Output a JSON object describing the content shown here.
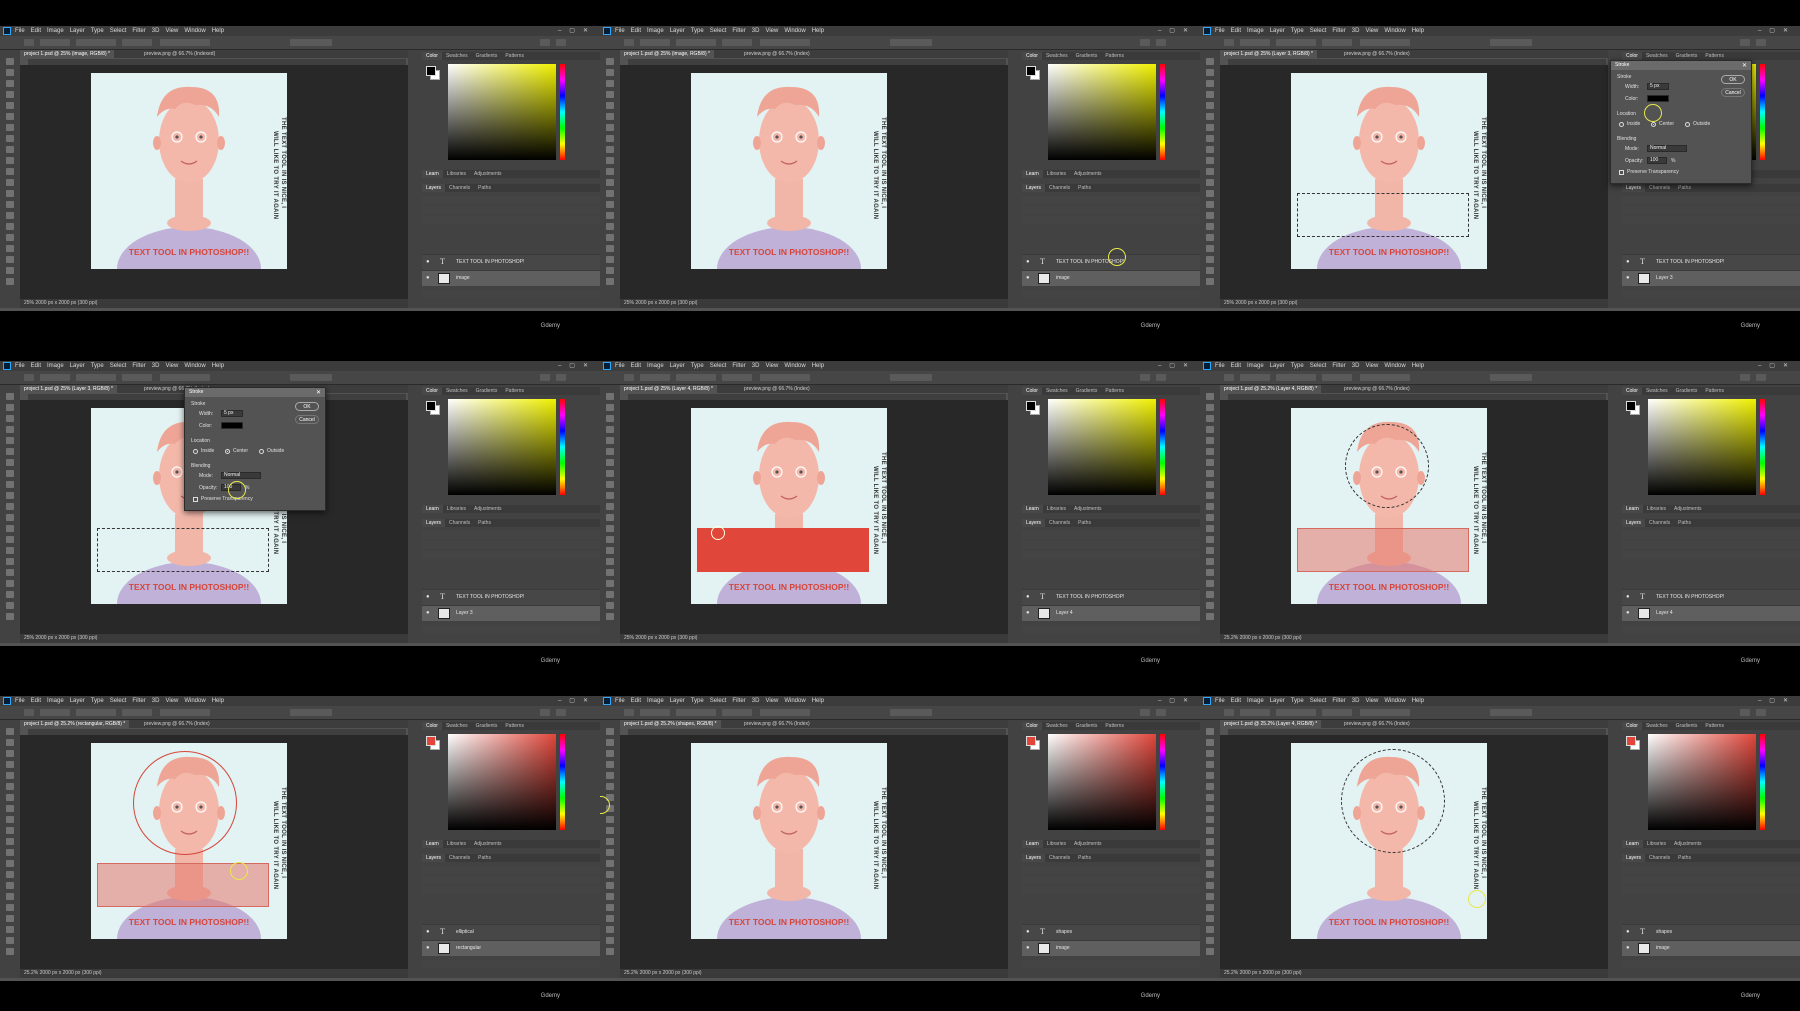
{
  "menu": [
    "File",
    "Edit",
    "Image",
    "Layer",
    "Type",
    "Select",
    "Filter",
    "3D",
    "View",
    "Window",
    "Help"
  ],
  "watermark": "Gdemy",
  "colors": {
    "accent_yellow": "#e8e84a",
    "title_red": "#d6453a",
    "fill_red": "#e0463a",
    "panel_dark": "#424242",
    "canvas_bg": "#e3f2f2"
  },
  "panel_tabs_top": [
    "Color",
    "Swatches",
    "Gradients",
    "Patterns"
  ],
  "panel_tabs_mid": [
    "Learn",
    "Libraries",
    "Adjustments"
  ],
  "panel_tabs_layers": [
    "Layers",
    "Channels",
    "Paths"
  ],
  "artwork": {
    "vertical_text_line1": "THE TEXT TOOL IN",
    "vertical_text_line2": "WILL LIKE TO TRY IT AGAIN",
    "vertical_text_mid": "IS NICE, I",
    "title": "TEXT TOOL IN PHOTOSHOP!!"
  },
  "layer_text": "TEXT TOOL IN PHOTOSHOP!",
  "stroke_dialog": {
    "title": "Stroke",
    "section_stroke": "Stroke",
    "width_label": "Width:",
    "width_value": "5 px",
    "color_label": "Color:",
    "location_label": "Location",
    "inside": "Inside",
    "center": "Center",
    "outside": "Outside",
    "blending_label": "Blending",
    "mode_label": "Mode:",
    "mode_value": "Normal",
    "opacity_label": "Opacity:",
    "opacity_value": "100",
    "opacity_unit": "%",
    "preserve": "Preserve Transparency",
    "ok": "OK",
    "cancel": "Cancel"
  },
  "frames": [
    {
      "tab": "project 1.psd @ 25% (image, RGB/8) *",
      "tab2": "preview.png @ 66.7% (Indexed)",
      "layer_top": "TEXT TOOL IN PHOTOSHOP!",
      "layer_bottom": "image",
      "status": "25%   2000 px x 2000 px (300 ppi)"
    },
    {
      "tab": "project 1.psd @ 25% (image, RGB/8) *",
      "tab2": "preview.png @ 66.7% (Index)",
      "layer_top": "TEXT TOOL IN PHOTOSHOP!",
      "layer_bottom": "image",
      "status": "25%   2000 px x 2000 px (300 ppi)"
    },
    {
      "tab": "project 1.psd @ 25% (Layer 3, RGB/8) *",
      "tab2": "preview.png @ 66.7% (Index)",
      "layer_top": "TEXT TOOL IN PHOTOSHOP!",
      "layer_bottom": "Layer 3",
      "status": "25%   2000 px x 2000 px (300 ppi)"
    },
    {
      "tab": "project 1.psd @ 25% (Layer 3, RGB/8) *",
      "tab2": "preview.png @ 66.7% (Index)",
      "layer_top": "TEXT TOOL IN PHOTOSHOP!",
      "layer_bottom": "Layer 3",
      "status": "25%   2000 px x 2000 px (300 ppi)"
    },
    {
      "tab": "project 1.psd @ 25% (Layer 4, RGB/8) *",
      "tab2": "preview.png @ 66.7% (Index)",
      "layer_top": "TEXT TOOL IN PHOTOSHOP!",
      "layer_bottom": "Layer 4",
      "status": "25%   2000 px x 2000 px (300 ppi)"
    },
    {
      "tab": "project 1.psd @ 25.2% (Layer 4, RGB/8) *",
      "tab2": "preview.png @ 66.7% (Index)",
      "layer_top": "TEXT TOOL IN PHOTOSHOP!",
      "layer_bottom": "Layer 4",
      "status": "25.2%   2000 px x 2000 px (300 ppi)"
    },
    {
      "tab": "project 1.psd @ 25.2% (rectangular, RGB/8) *",
      "tab2": "preview.png @ 66.7% (Index)",
      "layer_top": "elliptical",
      "layer_bottom": "rectangular",
      "status": "25.2%   2000 px x 2000 px (300 ppi)"
    },
    {
      "tab": "project 1.psd @ 25.2% (shapes, RGB/8) *",
      "tab2": "preview.png @ 66.7% (Index)",
      "layer_top": "shapes",
      "layer_bottom": "image",
      "status": "25.2%   2000 px x 2000 px (300 ppi)"
    },
    {
      "tab": "project 1.psd @ 25.2% (Layer 4, RGB/8) *",
      "tab2": "preview.png @ 66.7% (Index)",
      "layer_top": "shapes",
      "layer_bottom": "image",
      "status": "25.2%   2000 px x 2000 px (300 ppi)"
    }
  ]
}
